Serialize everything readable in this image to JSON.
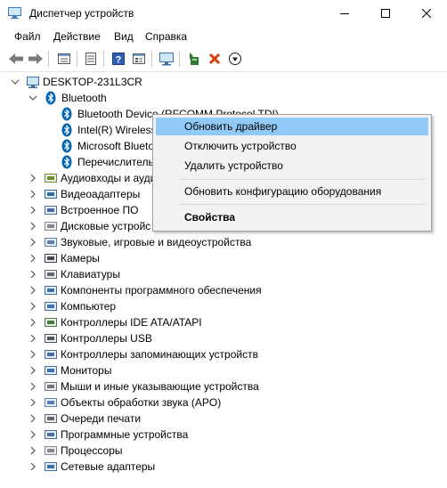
{
  "window": {
    "title": "Диспетчер устройств"
  },
  "menu": [
    "Файл",
    "Действие",
    "Вид",
    "Справка"
  ],
  "toolbar": [
    "back",
    "forward",
    "properties",
    "list",
    "help",
    "view-details",
    "scan",
    "update-driver",
    "remove",
    "install"
  ],
  "tree": {
    "root": "DESKTOP-231L3CR",
    "bluetooth": {
      "label": "Bluetooth",
      "children": [
        "Bluetooth Device (RFCOMM Protocol TDI)",
        "Intel(R) Wireless",
        "Microsoft Bluetoo",
        "Перечислитель"
      ]
    },
    "categories": [
      "Аудиовходы и аудио",
      "Видеоадаптеры",
      "Встроенное ПО",
      "Дисковые устройс",
      "Звуковые, игровые и видеоустройства",
      "Камеры",
      "Клавиатуры",
      "Компоненты программного обеспечения",
      "Компьютер",
      "Контроллеры IDE ATA/ATAPI",
      "Контроллеры USB",
      "Контроллеры запоминающих устройств",
      "Мониторы",
      "Мыши и иные указывающие устройства",
      "Объекты обработки звука (APO)",
      "Очереди печати",
      "Программные устройства",
      "Процессоры",
      "Сетевые адаптеры"
    ]
  },
  "context_menu": {
    "update_driver": "Обновить драйвер",
    "disable_device": "Отключить устройство",
    "uninstall_device": "Удалить устройство",
    "scan_hardware": "Обновить конфигурацию оборудования",
    "properties": "Свойства"
  },
  "colors": {
    "highlight": "#91c9f7",
    "bluetooth": "#0063b1",
    "remove": "#d83b01"
  }
}
